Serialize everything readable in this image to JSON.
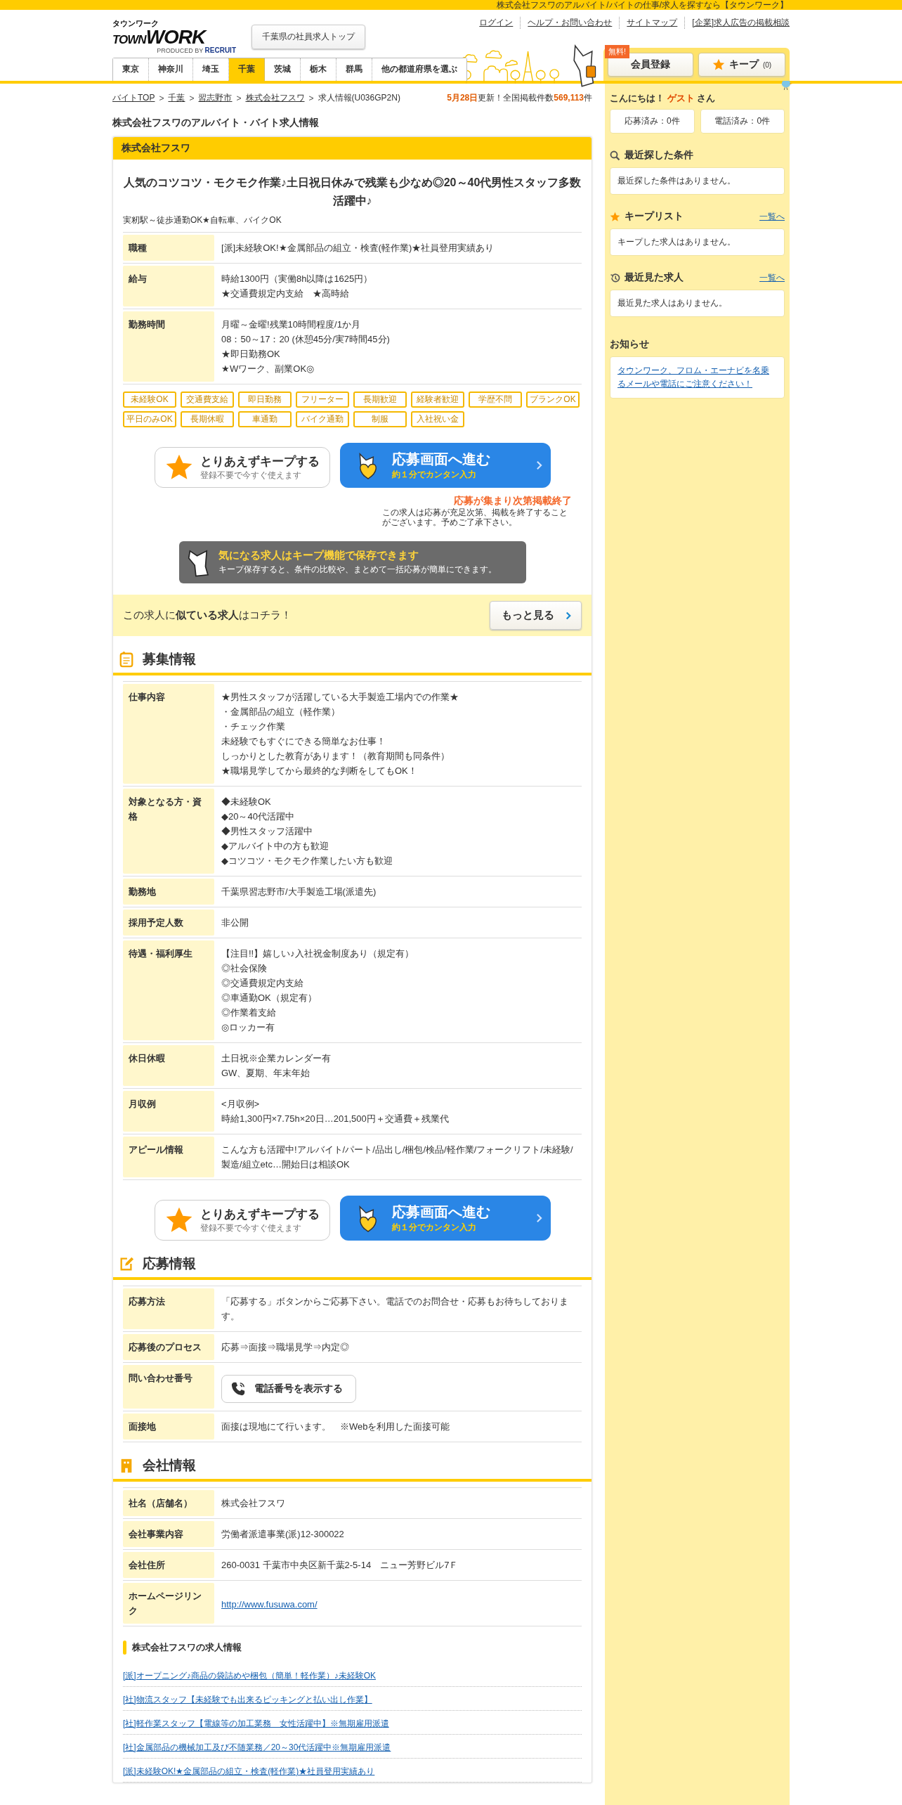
{
  "top_bar": {
    "tagline": "株式会社フスワのアルバイト/バイトの仕事/求人を探すなら【タウンワーク】"
  },
  "header": {
    "logo": {
      "kana": "タウンワーク",
      "town": "TOWN",
      "work": "WORK",
      "producer": "PRODUCED BY",
      "brand": "RECRUIT"
    },
    "prefecture_top": "千葉県の社員求人トップ",
    "links": [
      "ログイン",
      "ヘルプ・お問い合わせ",
      "サイトマップ",
      "[企業]求人広告の掲載相談"
    ],
    "free_badge": "無料!",
    "register": "会員登録",
    "keep": {
      "label": "キープ",
      "count": "(0)"
    },
    "tabs": [
      {
        "label": "東京",
        "selected": false
      },
      {
        "label": "神奈川",
        "selected": false
      },
      {
        "label": "埼玉",
        "selected": false
      },
      {
        "label": "千葉",
        "selected": true
      },
      {
        "label": "茨城",
        "selected": false
      },
      {
        "label": "栃木",
        "selected": false
      },
      {
        "label": "群馬",
        "selected": false
      },
      {
        "label": "他の都道府県を選ぶ",
        "selected": false
      }
    ]
  },
  "breadcrumb": {
    "separator": ">",
    "items": [
      {
        "label": "バイトTOP",
        "link": true
      },
      {
        "label": "千葉",
        "link": true
      },
      {
        "label": "習志野市",
        "link": true
      },
      {
        "label": "株式会社フスワ",
        "link": true
      },
      {
        "label": "求人情報(U036GP2N)",
        "link": false
      }
    ]
  },
  "update": {
    "date": "5月28日",
    "label": "更新！全国掲載件数",
    "count": "569,113",
    "unit": "件"
  },
  "page_title": "株式会社フスワのアルバイト・バイト求人情報",
  "job": {
    "company": "株式会社フスワ",
    "headline": "人気のコツコツ・モクモク作業♪土日祝日休みで残業も少なめ◎20～40代男性スタッフ多数活躍中♪",
    "access": "実籾駅～徒歩通勤OK★自転車、バイクOK",
    "summary": [
      {
        "label": "職種",
        "lines": [
          "[派]未経験OK!★金属部品の組立・検査(軽作業)★社員登用実績あり"
        ]
      },
      {
        "label": "給与",
        "lines": [
          "時給1300円（実働8h以降は1625円）",
          "★交通費規定内支給　★高時給"
        ]
      },
      {
        "label": "勤務時間",
        "lines": [
          "月曜～金曜!残業10時間程度/1か月",
          "08：50～17：20 (休憩45分/実7時間45分)",
          "★即日勤務OK",
          "★Wワーク、副業OK◎"
        ]
      }
    ],
    "tags": [
      "未経験OK",
      "交通費支給",
      "即日勤務",
      "フリーター",
      "長期歓迎",
      "経験者歓迎",
      "学歴不問",
      "ブランクOK",
      "平日のみOK",
      "長期休暇",
      "車通勤",
      "バイク通勤",
      "制服",
      "入社祝い金"
    ],
    "actions_top": {
      "keep_title": "とりあえずキープする",
      "keep_sub": "登録不要で今すぐ使えます",
      "apply_title": "応募画面へ進む",
      "apply_sub": "約１分でカンタン入力"
    },
    "notice": {
      "title": "応募が集まり次第掲載終了",
      "text": "この求人は応募が充足次第、掲載を終了することがございます。予めご了承下さい。"
    },
    "keep_banner": {
      "title": "気になる求人はキープ機能で保存できます",
      "text": "キープ保存すると、条件の比較や、まとめて一括応募が簡単にできます。"
    },
    "similar": {
      "text": "この求人に**似ている求人**はコチラ！",
      "button": "もっと見る"
    }
  },
  "recruit": {
    "title": "募集情報",
    "rows": [
      {
        "label": "仕事内容",
        "lines": [
          "★男性スタッフが活躍している大手製造工場内での作業★",
          "・金属部品の組立（軽作業）",
          "・チェック作業",
          "未経験でもすぐにできる簡単なお仕事！",
          "しっかりとした教育があります！（教育期間も同条件）",
          "★職場見学してから最終的な判断をしてもOK！"
        ]
      },
      {
        "label": "対象となる方・資格",
        "lines": [
          "◆未経験OK",
          "◆20～40代活躍中",
          "◆男性スタッフ活躍中",
          "◆アルバイト中の方も歓迎",
          "◆コツコツ・モクモク作業したい方も歓迎"
        ]
      },
      {
        "label": "勤務地",
        "lines": [
          "千葉県習志野市/大手製造工場(派遣先)"
        ]
      },
      {
        "label": "採用予定人数",
        "lines": [
          "非公開"
        ]
      },
      {
        "label": "待遇・福利厚生",
        "lines": [
          "【注目!!】嬉しい♪入社祝金制度あり（規定有）",
          "◎社会保険",
          "◎交通費規定内支給",
          "◎車通勤OK（規定有）",
          "◎作業着支給",
          "◎ロッカー有"
        ]
      },
      {
        "label": "休日休暇",
        "lines": [
          "土日祝※企業カレンダー有",
          "GW、夏期、年末年始"
        ]
      },
      {
        "label": "月収例",
        "lines": [
          "<月収例>",
          "時給1,300円×7.75h×20日…201,500円＋交通費＋残業代"
        ]
      },
      {
        "label": "アピール情報",
        "lines": [
          "こんな方も活躍中!アルバイト/パート/品出し/梱包/検品/軽作業/フォークリフト/未経験/製造/組立etc…開始日は相談OK"
        ]
      }
    ]
  },
  "actions_bottom": {
    "keep_title": "とりあえずキープする",
    "keep_sub": "登録不要で今すぐ使えます",
    "apply_title": "応募画面へ進む",
    "apply_sub": "約１分でカンタン入力"
  },
  "apply_info": {
    "title": "応募情報",
    "rows": [
      {
        "label": "応募方法",
        "kind": "text",
        "value": "「応募する」ボタンからご応募下さい。電話でのお問合せ・応募もお待ちしております。"
      },
      {
        "label": "応募後のプロセス",
        "kind": "text",
        "value": "応募⇒面接⇒職場見学⇒内定◎"
      },
      {
        "label": "問い合わせ番号",
        "kind": "phone",
        "value": "電話番号を表示する"
      },
      {
        "label": "面接地",
        "kind": "text",
        "value": "面接は現地にて行います。　※Webを利用した面接可能"
      }
    ]
  },
  "company_info": {
    "title": "会社情報",
    "rows": [
      {
        "label": "社名（店舗名）",
        "kind": "text",
        "value": "株式会社フスワ"
      },
      {
        "label": "会社事業内容",
        "kind": "text",
        "value": "労働者派遣事業(派)12-300022"
      },
      {
        "label": "会社住所",
        "kind": "text",
        "value": "260-0031 千葉市中央区新千葉2-5-14　ニュー芳野ビル7Ｆ"
      },
      {
        "label": "ホームページリンク",
        "kind": "link",
        "value": "http://www.fusuwa.com/"
      }
    ]
  },
  "other_jobs": {
    "title": "株式会社フスワの求人情報",
    "links": [
      "[派]オープニング♪商品の袋詰めや梱包（簡単！軽作業）♪未経験OK",
      "[社]物流スタッフ【未経験でも出来るピッキングと払い出し作業】",
      "[社]軽作業スタッフ【電線等の加工業務　女性活躍中】※無期雇用派遣",
      "[社]金属部品の機械加工及び不随業務／20～30代活躍中※無期雇用派遣",
      "[派]未経験OK!★金属部品の組立・検査(軽作業)★社員登用実績あり"
    ]
  },
  "sidebar": {
    "greeting": "こんにちは！",
    "user": "ゲスト",
    "honorific": "さん",
    "counts": [
      "応募済み：0件",
      "電話済み：0件"
    ],
    "panels": [
      {
        "kind": "search",
        "title": "最近探した条件",
        "empty": "最近探した条件はありません。"
      },
      {
        "kind": "keep",
        "title": "キープリスト",
        "link": "一覧へ",
        "empty": "キープした求人はありません。"
      },
      {
        "kind": "history",
        "title": "最近見た求人",
        "link": "一覧へ",
        "empty": "最近見た求人はありません。"
      }
    ],
    "news": {
      "title": "お知らせ",
      "link": "タウンワーク、フロム・エーナビを名乗るメールや電話にご注意ください！"
    }
  }
}
